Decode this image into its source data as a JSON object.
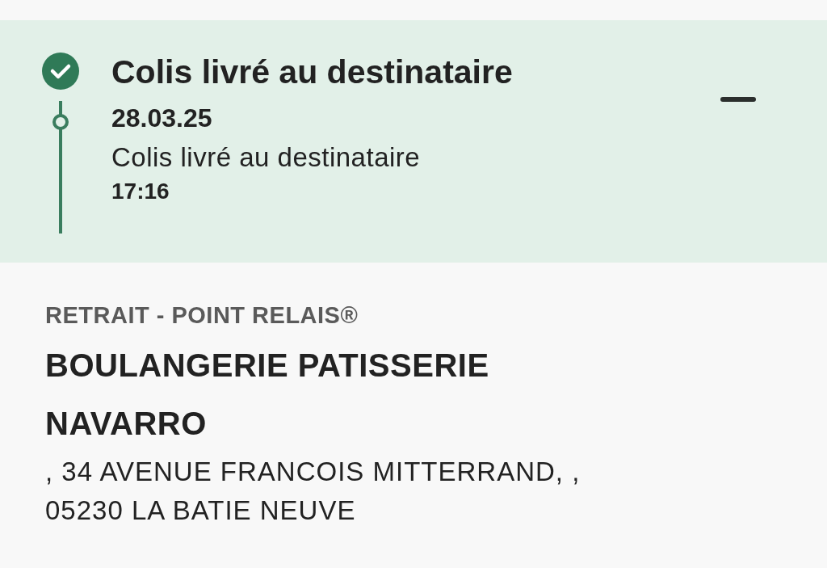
{
  "tracking_step": {
    "title": "Colis livré au destinataire",
    "completed": true,
    "expanded": true,
    "events": [
      {
        "date": "28.03.25",
        "description": "Colis livré au destinataire",
        "time": "17:16"
      }
    ]
  },
  "pickup": {
    "label": "RETRAIT - POINT RELAIS®",
    "name": "BOULANGERIE PATISSERIE NAVARRO",
    "address_lines": [
      ", 34 AVENUE FRANCOIS MITTERRAND, ,",
      "05230 LA BATIE NEUVE"
    ]
  }
}
